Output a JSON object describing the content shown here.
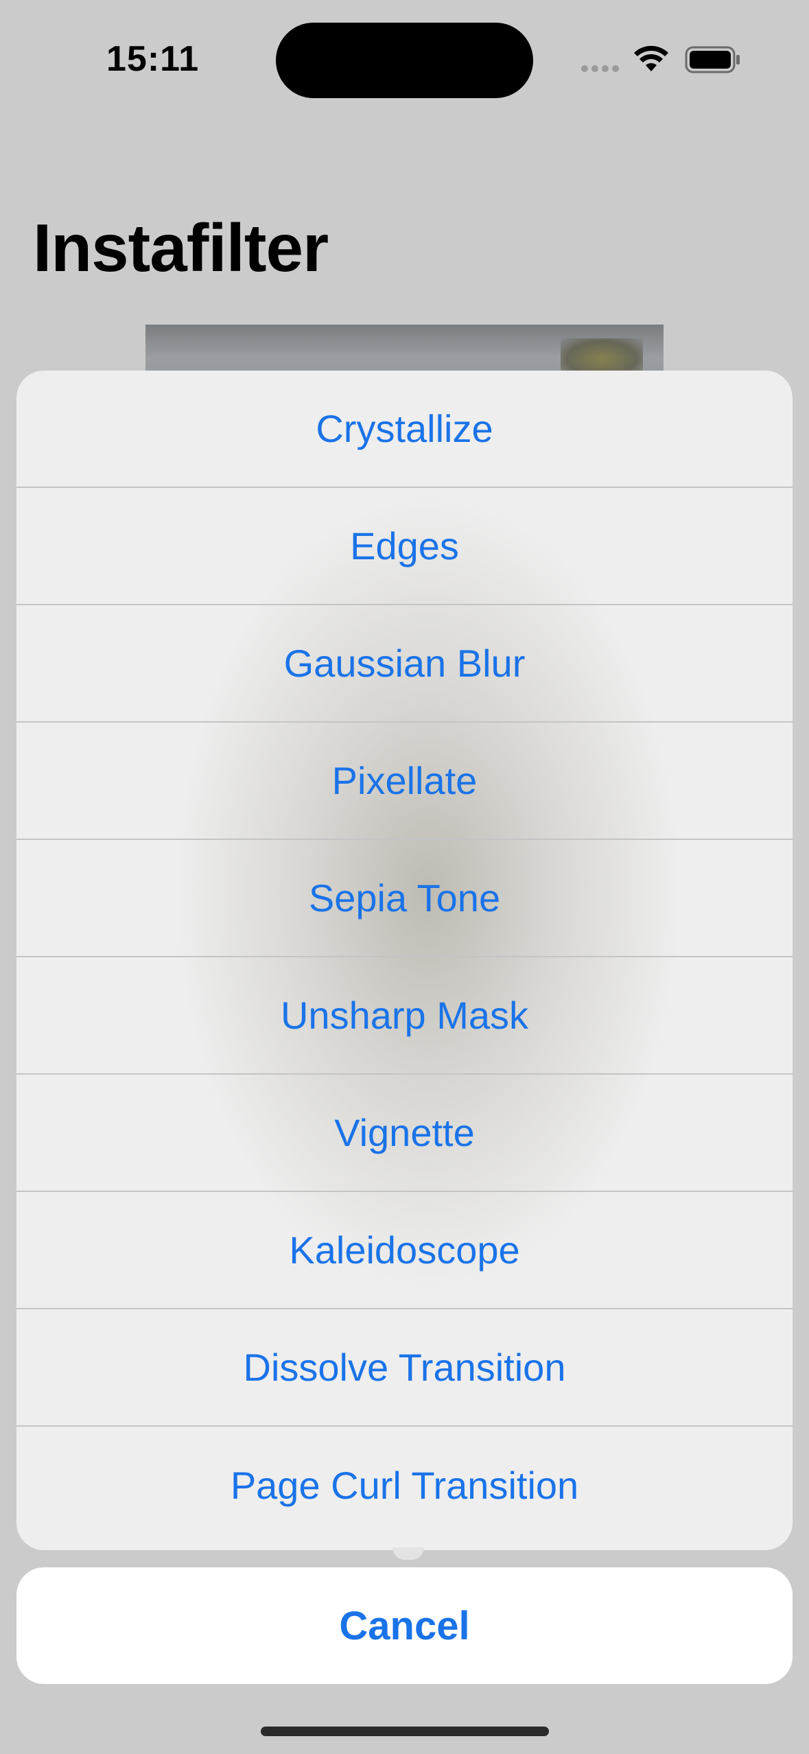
{
  "status_bar": {
    "time": "15:11",
    "icons": [
      "cellular-signal-icon",
      "wifi-icon",
      "battery-icon"
    ]
  },
  "header": {
    "title": "Instafilter"
  },
  "action_sheet": {
    "items": [
      {
        "label": "Crystallize"
      },
      {
        "label": "Edges"
      },
      {
        "label": "Gaussian Blur"
      },
      {
        "label": "Pixellate"
      },
      {
        "label": "Sepia Tone"
      },
      {
        "label": "Unsharp Mask"
      },
      {
        "label": "Vignette"
      },
      {
        "label": "Kaleidoscope"
      },
      {
        "label": "Dissolve Transition"
      },
      {
        "label": "Page Curl Transition"
      }
    ],
    "cancel_label": "Cancel"
  },
  "colors": {
    "accent": "#1a73e8",
    "background": "#cbcbcb",
    "sheet_background": "#eeeeee",
    "cancel_background": "#ffffff"
  }
}
